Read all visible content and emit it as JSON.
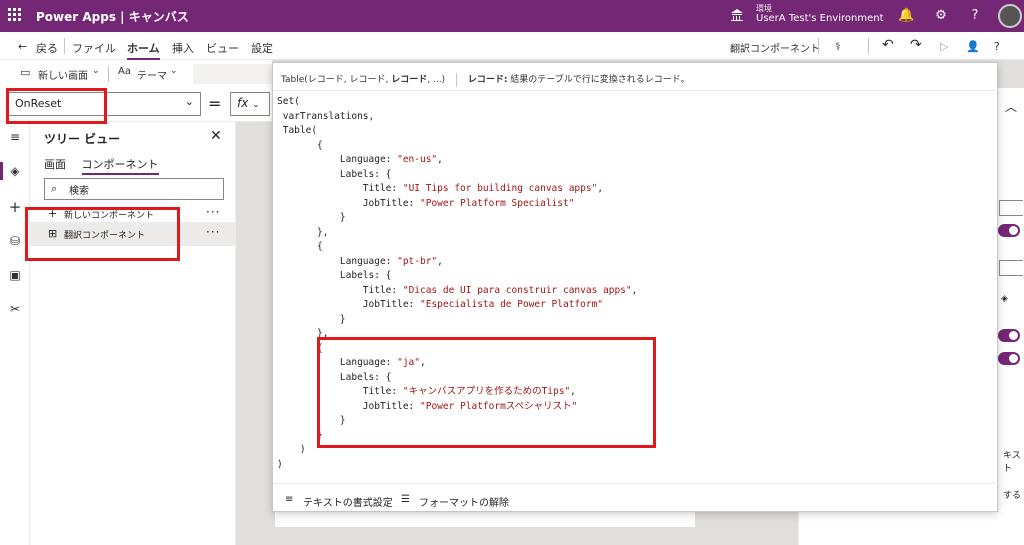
{
  "app": {
    "name": "Power Apps | キャンバス",
    "env_label": "環境",
    "env_name": "UserA Test's Environment"
  },
  "commands": {
    "back": "戻る",
    "file": "ファイル",
    "home": "ホーム",
    "insert": "挿入",
    "view": "ビュー",
    "settings": "設定",
    "component_name": "翻訳コンポーネント"
  },
  "toolbar": {
    "new_screen": "新しい画面",
    "theme": "テーマ"
  },
  "formula": {
    "property": "OnReset",
    "fx": "fx"
  },
  "tree": {
    "title": "ツリー ビュー",
    "tab_screens": "画面",
    "tab_components": "コンポーネント",
    "search_placeholder": "検索",
    "new_component": "新しいコンポーネント",
    "item": "翻訳コンポーネント"
  },
  "popup": {
    "sig": "Table(レコード, レコード, ",
    "sig_bold": "レコード",
    "sig_end": ", ...)",
    "desc_bold": "レコード:",
    "desc": " 結果のテーブルで行に変換されるレコード。",
    "format": "テキストの書式設定",
    "clear": "フォーマットの解除"
  },
  "code": [
    "Set(",
    " varTranslations,",
    " Table(",
    "       {",
    "           Language: \"en-us\",",
    "           Labels: {",
    "               Title: \"UI Tips for building canvas apps\",",
    "               JobTitle: \"Power Platform Specialist\"",
    "           }",
    "       },",
    "       {",
    "           Language: \"pt-br\",",
    "           Labels: {",
    "               Title: \"Dicas de UI para construir canvas apps\",",
    "               JobTitle: \"Especialista de Power Platform\"",
    "           }",
    "       },",
    "       {",
    "           Language: \"ja\",",
    "           Labels: {",
    "               Title: \"キャンバスアプリを作るためのTips\",",
    "               JobTitle: \"Power Platformスペシャリスト\"",
    "           }",
    "       }",
    "    )",
    ")"
  ],
  "right": {
    "t1": "キスト",
    "t2": "する"
  }
}
